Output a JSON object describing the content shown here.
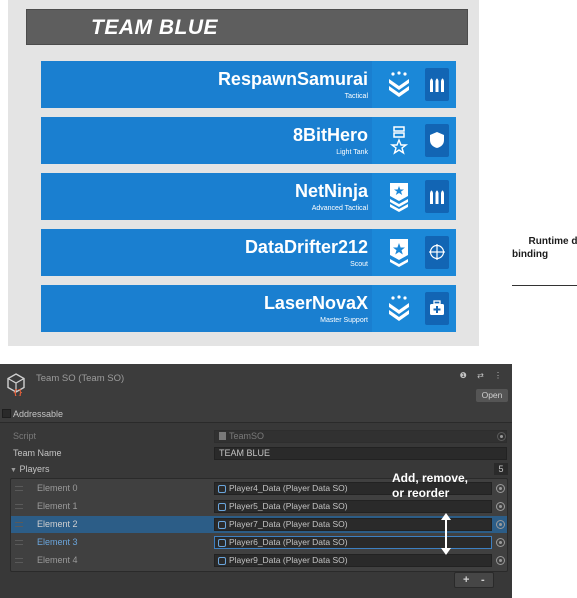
{
  "game": {
    "team_title": "TEAM BLUE",
    "accent": "#1b88d8",
    "players": [
      {
        "name": "RespawnSamurai",
        "role": "Tactical",
        "rank_icon": "chevron-stars-rank-icon",
        "class_icon": "ammo-icon"
      },
      {
        "name": "8BitHero",
        "role": "Light Tank",
        "rank_icon": "medal-star-rank-icon",
        "class_icon": "shield-icon"
      },
      {
        "name": "NetNinja",
        "role": "Advanced Tactical",
        "rank_icon": "star-chevrons-rank-icon",
        "class_icon": "ammo-icon"
      },
      {
        "name": "DataDrifter212",
        "role": "Scout",
        "rank_icon": "star-badge-rank-icon",
        "class_icon": "crosshair-icon"
      },
      {
        "name": "LaserNovaX",
        "role": "Master Support",
        "rank_icon": "chevron-stars-rank-icon",
        "class_icon": "medkit-icon"
      }
    ]
  },
  "annotation": {
    "runtime_line1": "Runtime d",
    "runtime_line2": "binding",
    "reorder_line1": "Add, remove,",
    "reorder_line2": "or reorder"
  },
  "inspector": {
    "title": "Team SO (Team SO)",
    "header_icons": "❶ ⇄ ⋮",
    "open_label": "Open",
    "addressable_label": "Addressable",
    "script_label": "Script",
    "script_value": "TeamSO",
    "team_name_label": "Team Name",
    "team_name_value": "TEAM BLUE",
    "players_label": "Players",
    "players_count": "5",
    "elements": [
      {
        "label": "Element 0",
        "value": "Player4_Data (Player Data SO)"
      },
      {
        "label": "Element 1",
        "value": "Player5_Data (Player Data SO)"
      },
      {
        "label": "Element 2",
        "value": "Player7_Data (Player Data SO)"
      },
      {
        "label": "Element 3",
        "value": "Player6_Data (Player Data SO)"
      },
      {
        "label": "Element 4",
        "value": "Player9_Data (Player Data SO)"
      }
    ],
    "plus_label": "+",
    "minus_label": "-"
  }
}
